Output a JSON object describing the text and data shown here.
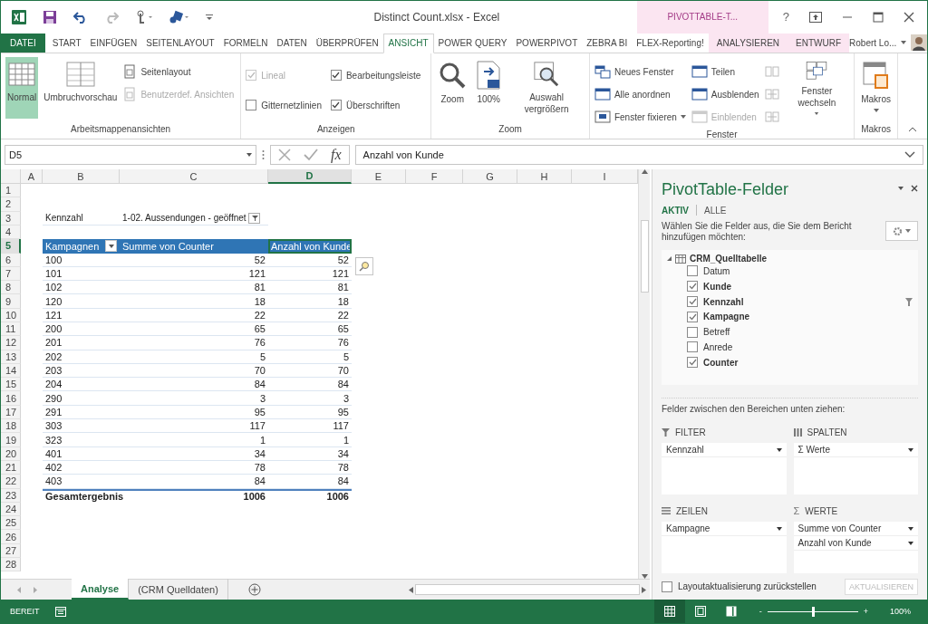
{
  "window": {
    "title": "Distinct Count.xlsx - Excel",
    "context_label": "PIVOTTABLE-T...",
    "help": "?",
    "user": "Robert Lo..."
  },
  "ribbon_tabs": [
    {
      "label": "DATEI",
      "kind": "file",
      "selected": false
    },
    {
      "label": "START",
      "kind": "normal",
      "selected": false
    },
    {
      "label": "EINFÜGEN",
      "kind": "normal",
      "selected": false
    },
    {
      "label": "SEITENLAYOUT",
      "kind": "normal",
      "selected": false
    },
    {
      "label": "FORMELN",
      "kind": "normal",
      "selected": false
    },
    {
      "label": "DATEN",
      "kind": "normal",
      "selected": false
    },
    {
      "label": "ÜBERPRÜFEN",
      "kind": "normal",
      "selected": false
    },
    {
      "label": "ANSICHT",
      "kind": "normal",
      "selected": true
    },
    {
      "label": "POWER QUERY",
      "kind": "normal",
      "selected": false
    },
    {
      "label": "POWERPIVOT",
      "kind": "normal",
      "selected": false
    },
    {
      "label": "ZEBRA BI",
      "kind": "normal",
      "selected": false
    },
    {
      "label": "FLEX-Reporting!",
      "kind": "normal",
      "selected": false
    },
    {
      "label": "ANALYSIEREN",
      "kind": "contextual",
      "selected": false
    },
    {
      "label": "ENTWURF",
      "kind": "contextual",
      "selected": false
    }
  ],
  "ribbon": {
    "groups": [
      {
        "label": "Arbeitsmappenansichten",
        "columns": [
          [
            {
              "kind": "large",
              "label": "Normal",
              "selected": true
            }
          ],
          [
            {
              "kind": "large",
              "label": "Umbruchvorschau",
              "selected": false
            }
          ],
          [
            {
              "kind": "small",
              "label": "Seitenlayout",
              "disabled": false
            },
            {
              "kind": "small",
              "label": "Benutzerdef. Ansichten",
              "disabled": true
            }
          ]
        ]
      },
      {
        "label": "Anzeigen",
        "columns": [
          [
            {
              "kind": "check",
              "label": "Lineal",
              "checked": true,
              "disabled": true
            },
            {
              "kind": "check",
              "label": "Gitternetzlinien",
              "checked": false,
              "disabled": false
            }
          ],
          [
            {
              "kind": "check",
              "label": "Bearbeitungsleiste",
              "checked": true,
              "disabled": false
            },
            {
              "kind": "check",
              "label": "Überschriften",
              "checked": true,
              "disabled": false
            }
          ]
        ]
      },
      {
        "label": "Zoom",
        "columns": [
          [
            {
              "kind": "large",
              "label": "Zoom"
            }
          ],
          [
            {
              "kind": "large",
              "label": "100%"
            }
          ],
          [
            {
              "kind": "large",
              "label": "Auswahl vergrößern"
            }
          ]
        ]
      },
      {
        "label": "Fenster",
        "columns": [
          [
            {
              "kind": "small",
              "label": "Neues Fenster",
              "disabled": false
            },
            {
              "kind": "small",
              "label": "Alle anordnen",
              "disabled": false
            },
            {
              "kind": "small",
              "label": "Fenster fixieren",
              "disabled": false,
              "dropdown": true
            }
          ],
          [
            {
              "kind": "small",
              "label": "Teilen",
              "disabled": false
            },
            {
              "kind": "small",
              "label": "Ausblenden",
              "disabled": false
            },
            {
              "kind": "small",
              "label": "Einblenden",
              "disabled": true
            }
          ],
          [
            {
              "kind": "icon",
              "disabled": true
            },
            {
              "kind": "icon",
              "disabled": true
            },
            {
              "kind": "icon",
              "disabled": true
            }
          ],
          [
            {
              "kind": "large",
              "label": "Fenster wechseln",
              "dropdown": true
            }
          ]
        ]
      },
      {
        "label": "Makros",
        "columns": [
          [
            {
              "kind": "large",
              "label": "Makros",
              "dropdown": true
            }
          ]
        ]
      }
    ]
  },
  "formula_bar": {
    "name_box": "D5",
    "function_label": "fx",
    "formula": "Anzahl von Kunde"
  },
  "sheet": {
    "columns": [
      {
        "label": "A",
        "selected": false
      },
      {
        "label": "B",
        "selected": false
      },
      {
        "label": "C",
        "selected": false
      },
      {
        "label": "D",
        "selected": true
      },
      {
        "label": "E",
        "selected": false
      },
      {
        "label": "F",
        "selected": false
      },
      {
        "label": "G",
        "selected": false
      },
      {
        "label": "H",
        "selected": false
      },
      {
        "label": "I",
        "selected": false
      }
    ],
    "rows": [
      {
        "label": "1",
        "selected": false
      },
      {
        "label": "2",
        "selected": false
      },
      {
        "label": "3",
        "selected": false
      },
      {
        "label": "4",
        "selected": false
      },
      {
        "label": "5",
        "selected": true
      },
      {
        "label": "6",
        "selected": false
      },
      {
        "label": "7",
        "selected": false
      },
      {
        "label": "8",
        "selected": false
      },
      {
        "label": "9",
        "selected": false
      },
      {
        "label": "10",
        "selected": false
      },
      {
        "label": "11",
        "selected": false
      },
      {
        "label": "12",
        "selected": false
      },
      {
        "label": "13",
        "selected": false
      },
      {
        "label": "14",
        "selected": false
      },
      {
        "label": "15",
        "selected": false
      },
      {
        "label": "16",
        "selected": false
      },
      {
        "label": "17",
        "selected": false
      },
      {
        "label": "18",
        "selected": false
      },
      {
        "label": "19",
        "selected": false
      },
      {
        "label": "20",
        "selected": false
      },
      {
        "label": "21",
        "selected": false
      },
      {
        "label": "22",
        "selected": false
      },
      {
        "label": "23",
        "selected": false
      },
      {
        "label": "24",
        "selected": false
      },
      {
        "label": "25",
        "selected": false
      },
      {
        "label": "26",
        "selected": false
      },
      {
        "label": "27",
        "selected": false
      },
      {
        "label": "28",
        "selected": false
      }
    ],
    "pivot": {
      "filter_label": "Kennzahl",
      "filter_value": "1-02. Aussendungen - geöffnet",
      "headers": [
        {
          "label": "Kampagnen",
          "selected": false
        },
        {
          "label": "Summe von Counter",
          "selected": false
        },
        {
          "label": "Anzahl von Kunde",
          "selected": true
        }
      ],
      "rows": [
        [
          "100",
          "52",
          "52"
        ],
        [
          "101",
          "121",
          "121"
        ],
        [
          "102",
          "81",
          "81"
        ],
        [
          "120",
          "18",
          "18"
        ],
        [
          "121",
          "22",
          "22"
        ],
        [
          "200",
          "65",
          "65"
        ],
        [
          "201",
          "76",
          "76"
        ],
        [
          "202",
          "5",
          "5"
        ],
        [
          "203",
          "70",
          "70"
        ],
        [
          "204",
          "84",
          "84"
        ],
        [
          "290",
          "3",
          "3"
        ],
        [
          "291",
          "95",
          "95"
        ],
        [
          "303",
          "117",
          "117"
        ],
        [
          "323",
          "1",
          "1"
        ],
        [
          "401",
          "34",
          "34"
        ],
        [
          "402",
          "78",
          "78"
        ],
        [
          "403",
          "84",
          "84"
        ]
      ],
      "total": [
        "Gesamtergebnis",
        "1006",
        "1006"
      ]
    }
  },
  "sheet_tabs": [
    {
      "label": "Analyse",
      "selected": true
    },
    {
      "label": "(CRM Quelldaten)",
      "selected": false
    }
  ],
  "pivot_panel": {
    "title": "PivotTable-Felder",
    "tabs": [
      {
        "label": "AKTIV",
        "selected": true
      },
      {
        "label": "ALLE",
        "selected": false
      }
    ],
    "instruction": "Wählen Sie die Felder aus, die Sie dem Bericht hinzufügen möchten:",
    "table": "CRM_Quelltabelle",
    "fields": [
      {
        "label": "Datum",
        "checked": false,
        "filtered": false
      },
      {
        "label": "Kunde",
        "checked": true,
        "filtered": false
      },
      {
        "label": "Kennzahl",
        "checked": true,
        "filtered": true
      },
      {
        "label": "Kampagne",
        "checked": true,
        "filtered": false
      },
      {
        "label": "Betreff",
        "checked": false,
        "filtered": false
      },
      {
        "label": "Anrede",
        "checked": false,
        "filtered": false
      },
      {
        "label": "Counter",
        "checked": true,
        "filtered": false
      }
    ],
    "hint": "Felder zwischen den Bereichen unten ziehen:",
    "areas": [
      {
        "title": "FILTER",
        "items": [
          "Kennzahl"
        ]
      },
      {
        "title": "SPALTEN",
        "items": [
          "Σ Werte"
        ]
      },
      {
        "title": "ZEILEN",
        "items": [
          "Kampagne"
        ]
      },
      {
        "title": "WERTE",
        "symbol": "Σ",
        "items": [
          "Summe von Counter",
          "Anzahl von Kunde"
        ]
      }
    ],
    "defer": {
      "label": "Layoutaktualisierung zurückstellen",
      "checked": false
    },
    "update_button": {
      "label": "AKTUALISIEREN",
      "disabled": true
    }
  },
  "status_bar": {
    "state": "BEREIT",
    "view_buttons": [
      {
        "selected": true
      },
      {
        "selected": false
      },
      {
        "selected": false
      }
    ],
    "zoom_out": "-",
    "zoom_slider": {
      "level": 0.5
    },
    "zoom_in": "+",
    "zoom": "100%"
  }
}
